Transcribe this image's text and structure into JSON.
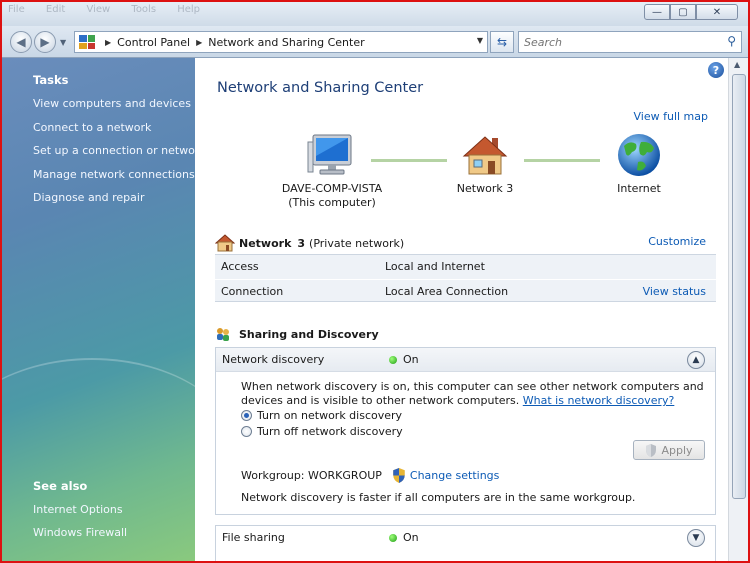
{
  "window": {
    "menu_ghost": [
      "File",
      "Edit",
      "View",
      "Tools",
      "Help"
    ],
    "controls": {
      "minimize": "—",
      "maximize": "▢",
      "close": "✕"
    }
  },
  "address": {
    "crumbs": [
      "Control Panel",
      "Network and Sharing Center"
    ],
    "search_placeholder": "Search"
  },
  "sidebar": {
    "tasks_heading": "Tasks",
    "tasks": [
      "View computers and devices",
      "Connect to a network",
      "Set up a connection or network",
      "Manage network connections",
      "Diagnose and repair"
    ],
    "see_also_heading": "See also",
    "see_also": [
      "Internet Options",
      "Windows Firewall"
    ]
  },
  "main": {
    "title": "Network and Sharing Center",
    "view_full_map": "View full map",
    "map": {
      "computer_name": "DAVE-COMP-VISTA",
      "computer_sub": "(This computer)",
      "network_name": "Network 3",
      "internet": "Internet"
    },
    "network": {
      "name": "Network",
      "number": "3",
      "type": "(Private network)",
      "customize": "Customize",
      "access_label": "Access",
      "access_value": "Local and Internet",
      "connection_label": "Connection",
      "connection_value": "Local Area Connection",
      "view_status": "View status"
    },
    "sharing": {
      "heading": "Sharing and Discovery",
      "discovery_label": "Network discovery",
      "discovery_state": "On",
      "discovery_desc": "When network discovery is on, this computer can see other network computers and devices and is visible to other network computers.",
      "discovery_link": "What is network discovery?",
      "radio_on": "Turn on network discovery",
      "radio_off": "Turn off network discovery",
      "apply": "Apply",
      "workgroup": "Workgroup: WORKGROUP",
      "change_settings": "Change settings",
      "workgroup_note": "Network discovery is faster if all computers are in the same workgroup.",
      "file_sharing_label": "File sharing",
      "file_sharing_state": "On"
    }
  }
}
